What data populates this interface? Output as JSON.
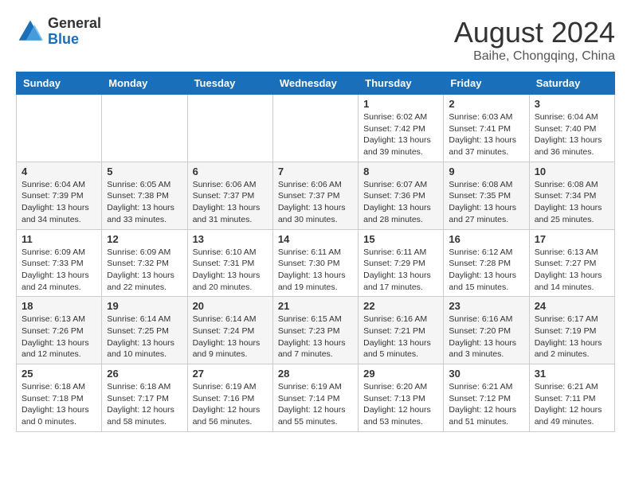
{
  "header": {
    "logo_general": "General",
    "logo_blue": "Blue",
    "month_title": "August 2024",
    "location": "Baihe, Chongqing, China"
  },
  "calendar": {
    "days_of_week": [
      "Sunday",
      "Monday",
      "Tuesday",
      "Wednesday",
      "Thursday",
      "Friday",
      "Saturday"
    ],
    "weeks": [
      [
        {
          "day": "",
          "info": ""
        },
        {
          "day": "",
          "info": ""
        },
        {
          "day": "",
          "info": ""
        },
        {
          "day": "",
          "info": ""
        },
        {
          "day": "1",
          "info": "Sunrise: 6:02 AM\nSunset: 7:42 PM\nDaylight: 13 hours\nand 39 minutes."
        },
        {
          "day": "2",
          "info": "Sunrise: 6:03 AM\nSunset: 7:41 PM\nDaylight: 13 hours\nand 37 minutes."
        },
        {
          "day": "3",
          "info": "Sunrise: 6:04 AM\nSunset: 7:40 PM\nDaylight: 13 hours\nand 36 minutes."
        }
      ],
      [
        {
          "day": "4",
          "info": "Sunrise: 6:04 AM\nSunset: 7:39 PM\nDaylight: 13 hours\nand 34 minutes."
        },
        {
          "day": "5",
          "info": "Sunrise: 6:05 AM\nSunset: 7:38 PM\nDaylight: 13 hours\nand 33 minutes."
        },
        {
          "day": "6",
          "info": "Sunrise: 6:06 AM\nSunset: 7:37 PM\nDaylight: 13 hours\nand 31 minutes."
        },
        {
          "day": "7",
          "info": "Sunrise: 6:06 AM\nSunset: 7:37 PM\nDaylight: 13 hours\nand 30 minutes."
        },
        {
          "day": "8",
          "info": "Sunrise: 6:07 AM\nSunset: 7:36 PM\nDaylight: 13 hours\nand 28 minutes."
        },
        {
          "day": "9",
          "info": "Sunrise: 6:08 AM\nSunset: 7:35 PM\nDaylight: 13 hours\nand 27 minutes."
        },
        {
          "day": "10",
          "info": "Sunrise: 6:08 AM\nSunset: 7:34 PM\nDaylight: 13 hours\nand 25 minutes."
        }
      ],
      [
        {
          "day": "11",
          "info": "Sunrise: 6:09 AM\nSunset: 7:33 PM\nDaylight: 13 hours\nand 24 minutes."
        },
        {
          "day": "12",
          "info": "Sunrise: 6:09 AM\nSunset: 7:32 PM\nDaylight: 13 hours\nand 22 minutes."
        },
        {
          "day": "13",
          "info": "Sunrise: 6:10 AM\nSunset: 7:31 PM\nDaylight: 13 hours\nand 20 minutes."
        },
        {
          "day": "14",
          "info": "Sunrise: 6:11 AM\nSunset: 7:30 PM\nDaylight: 13 hours\nand 19 minutes."
        },
        {
          "day": "15",
          "info": "Sunrise: 6:11 AM\nSunset: 7:29 PM\nDaylight: 13 hours\nand 17 minutes."
        },
        {
          "day": "16",
          "info": "Sunrise: 6:12 AM\nSunset: 7:28 PM\nDaylight: 13 hours\nand 15 minutes."
        },
        {
          "day": "17",
          "info": "Sunrise: 6:13 AM\nSunset: 7:27 PM\nDaylight: 13 hours\nand 14 minutes."
        }
      ],
      [
        {
          "day": "18",
          "info": "Sunrise: 6:13 AM\nSunset: 7:26 PM\nDaylight: 13 hours\nand 12 minutes."
        },
        {
          "day": "19",
          "info": "Sunrise: 6:14 AM\nSunset: 7:25 PM\nDaylight: 13 hours\nand 10 minutes."
        },
        {
          "day": "20",
          "info": "Sunrise: 6:14 AM\nSunset: 7:24 PM\nDaylight: 13 hours\nand 9 minutes."
        },
        {
          "day": "21",
          "info": "Sunrise: 6:15 AM\nSunset: 7:23 PM\nDaylight: 13 hours\nand 7 minutes."
        },
        {
          "day": "22",
          "info": "Sunrise: 6:16 AM\nSunset: 7:21 PM\nDaylight: 13 hours\nand 5 minutes."
        },
        {
          "day": "23",
          "info": "Sunrise: 6:16 AM\nSunset: 7:20 PM\nDaylight: 13 hours\nand 3 minutes."
        },
        {
          "day": "24",
          "info": "Sunrise: 6:17 AM\nSunset: 7:19 PM\nDaylight: 13 hours\nand 2 minutes."
        }
      ],
      [
        {
          "day": "25",
          "info": "Sunrise: 6:18 AM\nSunset: 7:18 PM\nDaylight: 13 hours\nand 0 minutes."
        },
        {
          "day": "26",
          "info": "Sunrise: 6:18 AM\nSunset: 7:17 PM\nDaylight: 12 hours\nand 58 minutes."
        },
        {
          "day": "27",
          "info": "Sunrise: 6:19 AM\nSunset: 7:16 PM\nDaylight: 12 hours\nand 56 minutes."
        },
        {
          "day": "28",
          "info": "Sunrise: 6:19 AM\nSunset: 7:14 PM\nDaylight: 12 hours\nand 55 minutes."
        },
        {
          "day": "29",
          "info": "Sunrise: 6:20 AM\nSunset: 7:13 PM\nDaylight: 12 hours\nand 53 minutes."
        },
        {
          "day": "30",
          "info": "Sunrise: 6:21 AM\nSunset: 7:12 PM\nDaylight: 12 hours\nand 51 minutes."
        },
        {
          "day": "31",
          "info": "Sunrise: 6:21 AM\nSunset: 7:11 PM\nDaylight: 12 hours\nand 49 minutes."
        }
      ]
    ]
  }
}
